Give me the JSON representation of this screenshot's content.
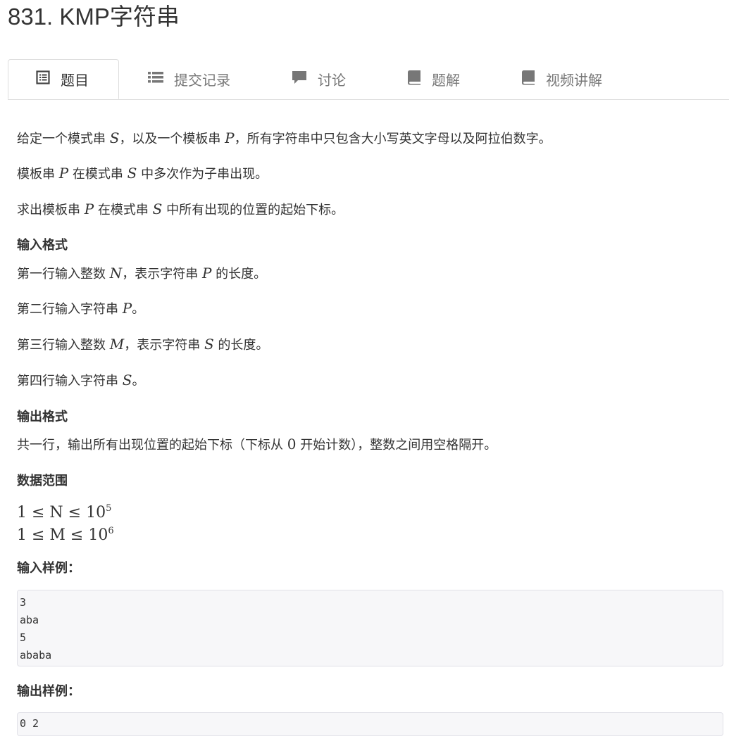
{
  "problem": {
    "title": "831. KMP字符串"
  },
  "tabs": [
    {
      "label": "题目",
      "icon": "document-list-icon",
      "active": true
    },
    {
      "label": "提交记录",
      "icon": "list-icon",
      "active": false
    },
    {
      "label": "讨论",
      "icon": "comment-icon",
      "active": false
    },
    {
      "label": "题解",
      "icon": "book-icon",
      "active": false
    },
    {
      "label": "视频讲解",
      "icon": "book-icon",
      "active": false
    }
  ],
  "statement": {
    "line1": {
      "pre": "给定一个模式串 ",
      "v1": "S",
      "mid": "，以及一个模板串 ",
      "v2": "P",
      "post": "，所有字符串中只包含大小写英文字母以及阿拉伯数字。"
    },
    "line2": {
      "pre": "模板串 ",
      "v1": "P",
      "mid": " 在模式串 ",
      "v2": "S",
      "post": " 中多次作为子串出现。"
    },
    "line3": {
      "pre": "求出模板串 ",
      "v1": "P",
      "mid": " 在模式串 ",
      "v2": "S",
      "post": " 中所有出现的位置的起始下标。"
    }
  },
  "input_format": {
    "heading": "输入格式",
    "line1": {
      "pre": "第一行输入整数 ",
      "v1": "N",
      "mid": "，表示字符串 ",
      "v2": "P",
      "post": " 的长度。"
    },
    "line2": {
      "pre": "第二行输入字符串 ",
      "v1": "P",
      "post": "。"
    },
    "line3": {
      "pre": "第三行输入整数 ",
      "v1": "M",
      "mid": "，表示字符串 ",
      "v2": "S",
      "post": " 的长度。"
    },
    "line4": {
      "pre": "第四行输入字符串 ",
      "v1": "S",
      "post": "。"
    }
  },
  "output_format": {
    "heading": "输出格式",
    "pre": "共一行，输出所有出现位置的起始下标（下标从 ",
    "zero": "0",
    "post": " 开始计数），整数之间用空格隔开。"
  },
  "data_range": {
    "heading": "数据范围",
    "line1": {
      "expr": "1 ≤ N ≤ 10",
      "exp": "5"
    },
    "line2": {
      "expr": "1 ≤ M ≤ 10",
      "exp": "6"
    }
  },
  "sample_input": {
    "heading": "输入样例：",
    "text": "3\naba\n5\nababa"
  },
  "sample_output": {
    "heading": "输出样例：",
    "text": "0 2"
  }
}
